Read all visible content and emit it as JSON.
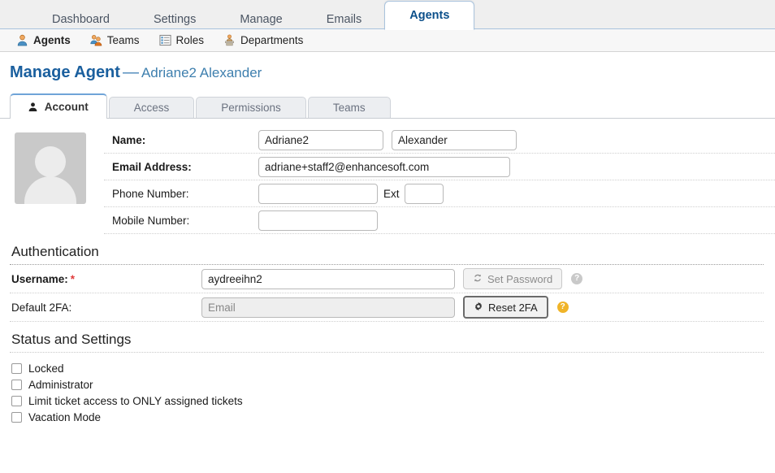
{
  "top_nav": {
    "tabs": [
      {
        "label": "Dashboard",
        "active": false
      },
      {
        "label": "Settings",
        "active": false
      },
      {
        "label": "Manage",
        "active": false
      },
      {
        "label": "Emails",
        "active": false
      },
      {
        "label": "Agents",
        "active": true
      }
    ]
  },
  "sub_nav": {
    "items": [
      {
        "label": "Agents",
        "icon": "agent-person-icon",
        "active": true
      },
      {
        "label": "Teams",
        "icon": "teams-people-icon",
        "active": false
      },
      {
        "label": "Roles",
        "icon": "roles-list-icon",
        "active": false
      },
      {
        "label": "Departments",
        "icon": "departments-podium-icon",
        "active": false
      }
    ]
  },
  "page": {
    "title": "Manage Agent",
    "dash": "—",
    "subject": "Adriane2 Alexander"
  },
  "inner_tabs": [
    {
      "label": "Account",
      "active": true,
      "icon": "person-icon"
    },
    {
      "label": "Access",
      "active": false
    },
    {
      "label": "Permissions",
      "active": false
    },
    {
      "label": "Teams",
      "active": false
    }
  ],
  "account": {
    "avatar_alt": "agent-avatar-placeholder",
    "rows": {
      "name_label": "Name:",
      "first_name_value": "Adriane2",
      "first_name_placeholder": "",
      "last_name_value": "Alexander",
      "last_name_placeholder": "",
      "email_label": "Email Address:",
      "email_value": "adriane+staff2@enhancesoft.com",
      "email_placeholder": "",
      "phone_label": "Phone Number:",
      "phone_value": "",
      "phone_placeholder": "",
      "ext_label": "Ext",
      "ext_value": "",
      "mobile_label": "Mobile Number:",
      "mobile_value": "",
      "mobile_placeholder": ""
    }
  },
  "authentication": {
    "heading": "Authentication",
    "username_label": "Username:",
    "username_required_mark": "*",
    "username_value": "aydreeihn2",
    "set_password_label": "Set Password",
    "set_password_icon": "refresh-icon",
    "set_password_help": "?",
    "twofa_label": "Default 2FA:",
    "twofa_value": "",
    "twofa_placeholder": "Email",
    "reset_2fa_label": "Reset 2FA",
    "reset_2fa_icon": "gear-icon",
    "reset_2fa_help": "?"
  },
  "status_settings": {
    "heading": "Status and Settings",
    "checkboxes": [
      {
        "label": "Locked",
        "checked": false
      },
      {
        "label": "Administrator",
        "checked": false
      },
      {
        "label": "Limit ticket access to ONLY assigned tickets",
        "checked": false
      },
      {
        "label": "Vacation Mode",
        "checked": false
      }
    ]
  },
  "colors": {
    "accent_blue": "#1a5f9e",
    "active_tab_border": "#6fa4d8",
    "required_red": "#e03b3b",
    "help_warn": "#f0b429"
  }
}
